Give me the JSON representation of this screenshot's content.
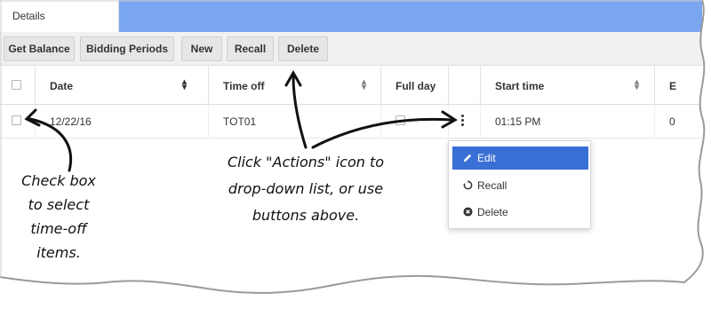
{
  "tabs": {
    "active_label": "Details"
  },
  "toolbar": {
    "buttons": [
      "Get Balance",
      "Bidding Periods",
      "New",
      "Recall",
      "Delete"
    ]
  },
  "table": {
    "headers": [
      "Date",
      "Time off",
      "Full day",
      "Start time",
      "E"
    ],
    "row": {
      "date": "12/22/16",
      "time_off": "TOT01",
      "start_time": "01:15 PM",
      "end_partial": "0"
    }
  },
  "actions_menu": {
    "items": [
      {
        "label": "Edit",
        "icon": "pencil-icon",
        "active": true
      },
      {
        "label": "Recall",
        "icon": "refresh-icon",
        "active": false
      },
      {
        "label": "Delete",
        "icon": "x-circle-icon",
        "active": false
      }
    ]
  },
  "annotations": {
    "checkbox_note": [
      "Check box",
      "to select",
      "time-off",
      "items."
    ],
    "actions_note": [
      "Click \"Actions\" icon to",
      "drop-down list, or use",
      "buttons above."
    ]
  },
  "colors": {
    "tabbar": "#7aa6f0",
    "menu_active": "#3a6fd6"
  }
}
